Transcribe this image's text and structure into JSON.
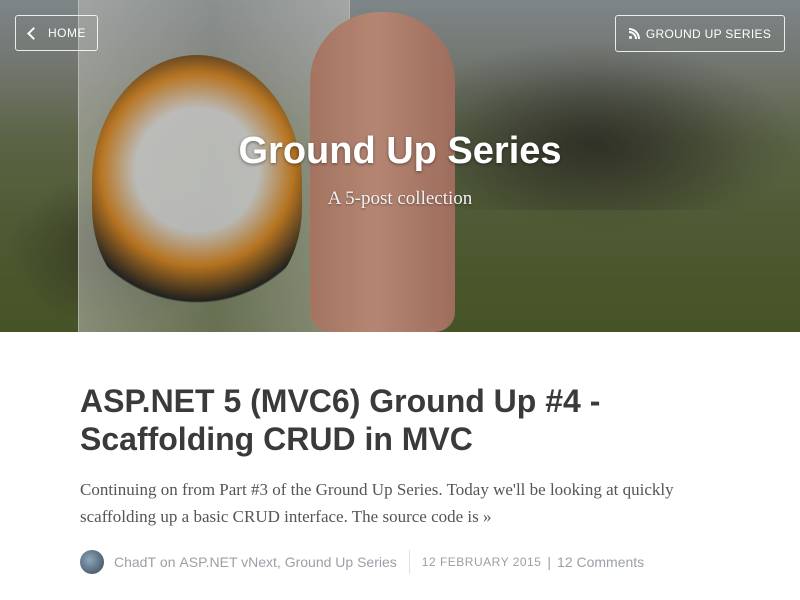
{
  "header": {
    "home_label": "HOME",
    "series_label": "GROUND UP SERIES",
    "title": "Ground Up Series",
    "subtitle": "A 5-post collection"
  },
  "post": {
    "title": "ASP.NET 5 (MVC6) Ground Up #4 - Scaffolding CRUD in MVC",
    "excerpt": "Continuing on from Part #3 of the Ground Up Series. Today we'll be looking at quickly scaffolding up a basic CRUD interface. The source code is »",
    "author": "ChadT",
    "on_word": "on",
    "tags": [
      "ASP.NET vNext",
      "Ground Up Series"
    ],
    "tag_separator": ", ",
    "date": "12 FEBRUARY 2015",
    "date_separator": "|",
    "comments": "12 Comments"
  },
  "icons": {
    "home": "chevron-left-icon",
    "series": "rss-icon"
  }
}
